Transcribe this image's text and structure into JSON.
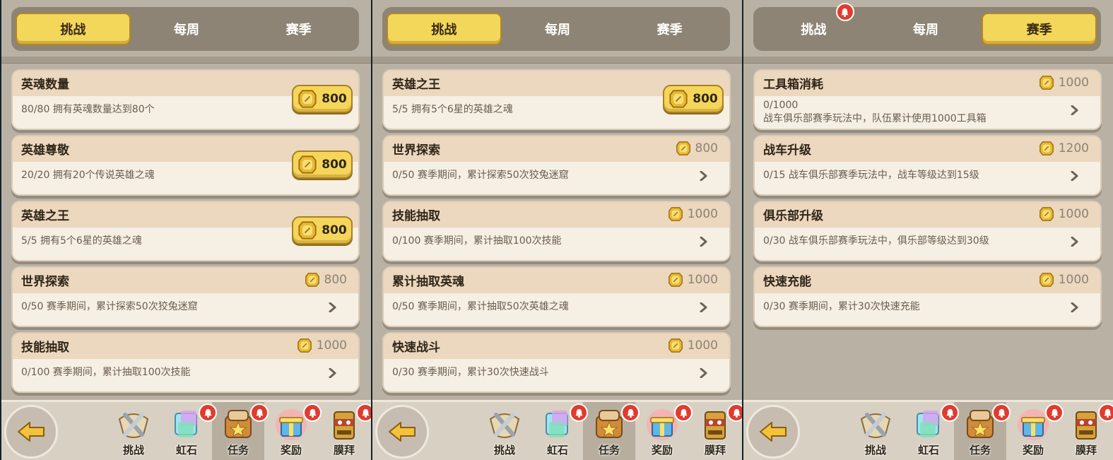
{
  "panels": [
    {
      "tabs": [
        {
          "label": "挑战",
          "active": true
        },
        {
          "label": "每周",
          "active": false
        },
        {
          "label": "赛季",
          "active": false
        }
      ],
      "tasks": [
        {
          "title": "英魂数量",
          "desc": "80/80 拥有英魂数量达到80个",
          "reward": "800",
          "claimable": true
        },
        {
          "title": "英雄尊敬",
          "desc": "20/20 拥有20个传说英雄之魂",
          "reward": "800",
          "claimable": true
        },
        {
          "title": "英雄之王",
          "desc": "5/5 拥有5个6星的英雄之魂",
          "reward": "800",
          "claimable": true
        },
        {
          "title": "世界探索",
          "desc": "0/50 赛季期间，累计探索50次狡兔迷窟",
          "reward": "800",
          "claimable": false
        },
        {
          "title": "技能抽取",
          "desc": "0/100 赛季期间，累计抽取100次技能",
          "reward": "1000",
          "claimable": false
        }
      ]
    },
    {
      "tabs": [
        {
          "label": "挑战",
          "active": true
        },
        {
          "label": "每周",
          "active": false
        },
        {
          "label": "赛季",
          "active": false
        }
      ],
      "tasks": [
        {
          "title": "英雄之王",
          "desc": "5/5 拥有5个6星的英雄之魂",
          "reward": "800",
          "claimable": true
        },
        {
          "title": "世界探索",
          "desc": "0/50 赛季期间，累计探索50次狡兔迷窟",
          "reward": "800",
          "claimable": false
        },
        {
          "title": "技能抽取",
          "desc": "0/100 赛季期间，累计抽取100次技能",
          "reward": "1000",
          "claimable": false
        },
        {
          "title": "累计抽取英魂",
          "desc": "0/50 赛季期间，累计抽取50次英雄之魂",
          "reward": "1000",
          "claimable": false
        },
        {
          "title": "快速战斗",
          "desc": "0/30 赛季期间，累计30次快速战斗",
          "reward": "1000",
          "claimable": false
        }
      ]
    },
    {
      "tabs": [
        {
          "label": "挑战",
          "active": false,
          "badge": true
        },
        {
          "label": "每周",
          "active": false
        },
        {
          "label": "赛季",
          "active": true
        }
      ],
      "tasks": [
        {
          "title": "工具箱消耗",
          "desc": "0/1000",
          "desc2": "战车俱乐部赛季玩法中，队伍累计使用1000工具箱",
          "reward": "1000",
          "claimable": false
        },
        {
          "title": "战车升级",
          "desc": "0/15 战车俱乐部赛季玩法中，战车等级达到15级",
          "reward": "1200",
          "claimable": false
        },
        {
          "title": "俱乐部升级",
          "desc": "0/30 战车俱乐部赛季玩法中，俱乐部等级达到30级",
          "reward": "1000",
          "claimable": false
        },
        {
          "title": "快速充能",
          "desc": "0/30 赛季期间，累计30次快速充能",
          "reward": "1000",
          "claimable": false
        }
      ]
    }
  ],
  "bottom_nav": [
    {
      "label": "挑战",
      "icon": "crossed-swords-icon",
      "badge": false
    },
    {
      "label": "虹石",
      "icon": "rainbow-crystal-icon",
      "badge": true
    },
    {
      "label": "任务",
      "icon": "quest-scroll-icon",
      "badge": true,
      "active": true
    },
    {
      "label": "奖励",
      "icon": "gift-box-icon",
      "badge": true
    },
    {
      "label": "膜拜",
      "icon": "totem-icon",
      "badge": true
    }
  ],
  "colors": {
    "gold": "#f6d65a",
    "badge_red": "#e23b2e",
    "panel_bg": "#b9b1a3",
    "card_bg": "#f5efe4"
  }
}
